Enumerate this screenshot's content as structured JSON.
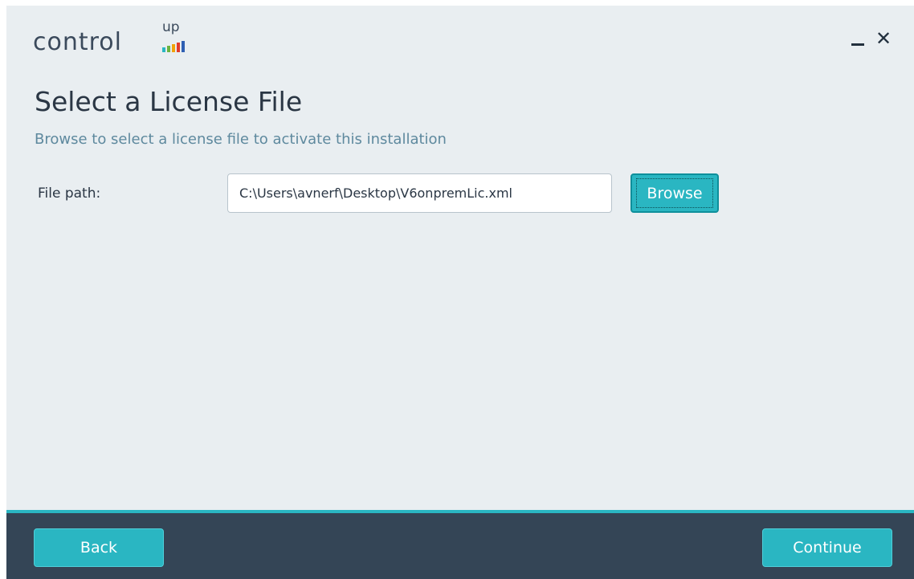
{
  "app": {
    "logo_word": "control",
    "logo_up": "up",
    "logo_bar_colors": [
      "#2ab6c2",
      "#6cb33f",
      "#f0a30a",
      "#e23b2a",
      "#2f5fb3"
    ]
  },
  "window_controls": {
    "minimize_icon": "minimize-icon",
    "close_icon": "close-icon",
    "close_glyph": "✕"
  },
  "page": {
    "title": "Select a License File",
    "subtitle": "Browse to select a license file to activate this installation"
  },
  "form": {
    "file_path_label": "File path:",
    "file_path_value": "C:\\Users\\avnerf\\Desktop\\V6onpremLic.xml",
    "browse_label": "Browse"
  },
  "footer": {
    "back_label": "Back",
    "continue_label": "Continue"
  },
  "colors": {
    "accent": "#2ab6c2",
    "footer_bg": "#344556",
    "window_bg": "#e9eef1",
    "subtitle": "#5e899e"
  }
}
